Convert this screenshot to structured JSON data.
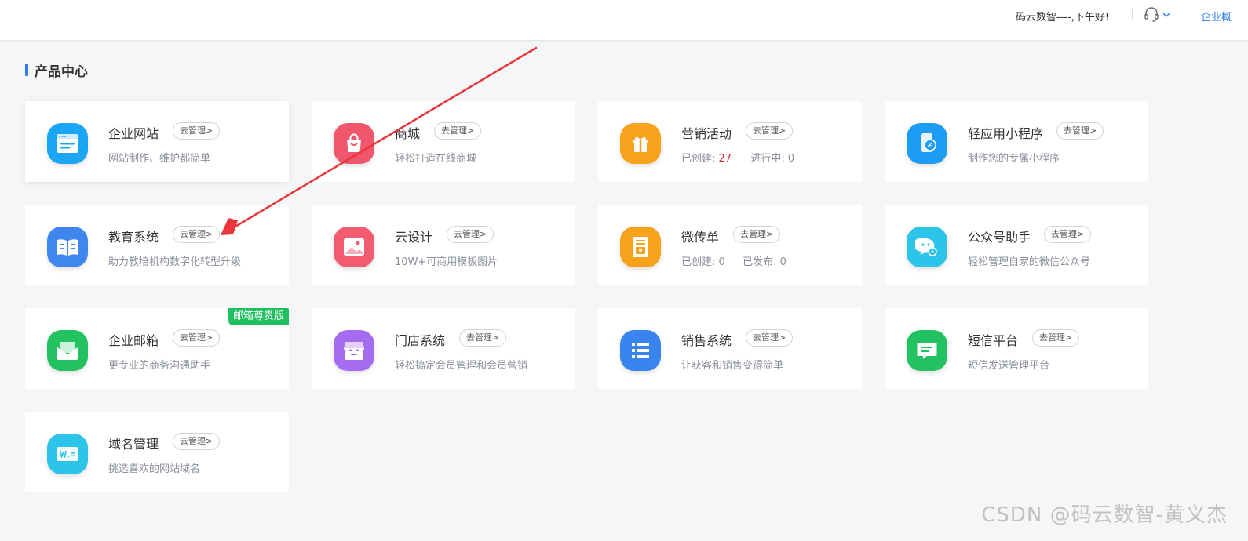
{
  "header": {
    "greeting": "码云数智----,下午好!",
    "enterprise_link": "企业概"
  },
  "section": {
    "title": "产品中心"
  },
  "cards": [
    {
      "name": "企业网站",
      "manage": "去管理>",
      "desc": "网站制作、维护都简单",
      "color": "#1aa6f5",
      "icon": "browser-window-icon"
    },
    {
      "name": "商城",
      "manage": "去管理>",
      "desc": "轻松打造在线商城",
      "color": "#f0566c",
      "icon": "shopping-bag-icon"
    },
    {
      "name": "营销活动",
      "manage": "去管理>",
      "desc_label_1": "已创建:",
      "desc_value_1": "27",
      "desc_label_2": "进行中:",
      "desc_value_2": "0",
      "color": "#f7a21b",
      "icon": "gift-icon"
    },
    {
      "name": "轻应用小程序",
      "manage": "去管理>",
      "desc": "制作您的专属小程序",
      "color": "#1e9cf4",
      "icon": "mini-program-phone-icon"
    },
    {
      "name": "教育系统",
      "manage": "去管理>",
      "desc": "助力教培机构数字化转型升级",
      "color": "#3f86ef",
      "icon": "open-book-icon"
    },
    {
      "name": "云设计",
      "manage": "去管理>",
      "desc": "10W+可商用模板图片",
      "color": "#f25c70",
      "icon": "image-picture-icon"
    },
    {
      "name": "微传单",
      "manage": "去管理>",
      "desc_label_1": "已创建:",
      "desc_value_1": "0",
      "desc_label_2": "已发布:",
      "desc_value_2": "0",
      "color": "#f7a21b",
      "icon": "flyer-icon"
    },
    {
      "name": "公众号助手",
      "manage": "去管理>",
      "desc": "轻松管理自家的微信公众号",
      "color": "#2cc4e8",
      "icon": "chat-bubble-gear-icon"
    },
    {
      "name": "企业邮箱",
      "manage": "去管理>",
      "desc": "更专业的商务沟通助手",
      "badge": "邮箱尊贵版",
      "color": "#21c25f",
      "icon": "envelope-icon"
    },
    {
      "name": "门店系统",
      "manage": "去管理>",
      "desc": "轻松搞定会员管理和会员营销",
      "color": "#a56cf0",
      "icon": "store-front-icon"
    },
    {
      "name": "销售系统",
      "manage": "去管理>",
      "desc": "让获客和销售变得简单",
      "color": "#3a84ef",
      "icon": "list-icon"
    },
    {
      "name": "短信平台",
      "manage": "去管理>",
      "desc": "短信发送管理平台",
      "color": "#21c25f",
      "icon": "message-icon"
    },
    {
      "name": "域名管理",
      "manage": "去管理>",
      "desc": "挑选喜欢的网站域名",
      "color": "#2cc4e8",
      "icon": "domain-tag-icon"
    }
  ],
  "watermark": "CSDN @码云数智-黄义杰",
  "annotation": {
    "arrow_color": "#e8343a"
  }
}
